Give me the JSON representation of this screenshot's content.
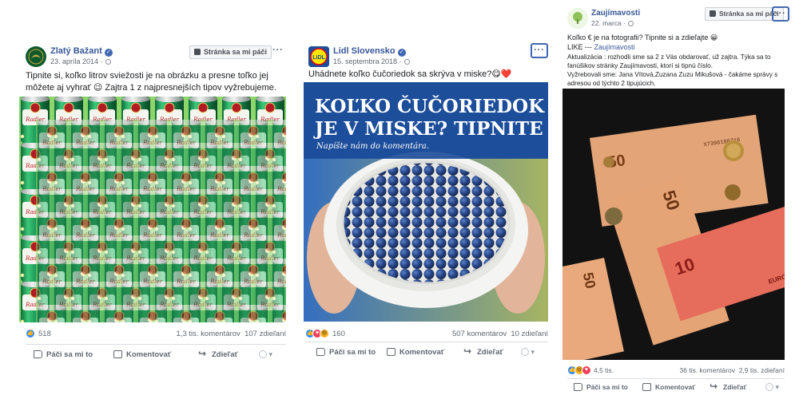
{
  "posts": [
    {
      "page_name": "Zlatý Bažant",
      "date": "23. apríla 2014 ·",
      "like_page_label": "Stránka sa mi páči",
      "more_label": "···",
      "text": "Tipnite si, koľko litrov sviežosti je na obrázku a presne toľko jej môžete aj vyhrať 😉 Zajtra 1 z najpresnejších tipov vyžrebujeme.",
      "image": {
        "can_text": "Zlatý Radler"
      },
      "reaction_count": "518",
      "comments": "1,3 tis. komentárov",
      "shares": "107 zdieľaní",
      "actions": {
        "like": "Páči sa mi to",
        "comment": "Komentovať",
        "share": "Zdieľať"
      }
    },
    {
      "page_name": "Lidl Slovensko",
      "date": "15. septembra 2018 ·",
      "more_label": "···",
      "text": "Uhádnete koľko čučoriedok sa skrýva v miske?😋❤️",
      "image": {
        "logo_text": "LIDL",
        "headline_line1": "KOĽKO ČUČORIEDOK",
        "headline_line2": "JE V MISKE? TIPNITE SI!",
        "subline": "Napíšte nám do komentára."
      },
      "reaction_count": "160",
      "comments": "507 komentárov",
      "shares": "10 zdieľaní",
      "actions": {
        "like": "Páči sa mi to",
        "comment": "Komentovať",
        "share": "Zdieľať"
      }
    },
    {
      "page_name": "Zaujímavosti",
      "date": "22. marca ·",
      "like_page_label": "Stránka sa mi páči",
      "more_label": "···",
      "text_line1": "Koľko € je na fotografii? Tipnite si a zdieľajte 😀",
      "text_line2_prefix": "LIKE --- ",
      "text_line2_link": "Zaujímavosti",
      "update": "Aktualizácia : rozhodli sme sa 2 z Vás obdarovať, už zajtra. Týka sa to fanúšikov stránky Zaujímavosti, ktorí si tipnú číslo.",
      "winners": "Vyžrebovali sme: Jana Vítová,Zuzana Zuzu Mikušová - čakáme správy s adresou od týchto 2 tipujúcich.",
      "image": {
        "note_50": "50",
        "note_10": "10",
        "euro": "EURO"
      },
      "reaction_count": "4,5 tis.",
      "comments": "36 tis. komentárov",
      "shares": "2,9 tis. zdieľaní",
      "actions": {
        "like": "Páči sa mi to",
        "comment": "Komentovať",
        "share": "Zdieľať"
      }
    }
  ],
  "colors": {
    "facebook_blue": "#4267b2",
    "link_blue": "#385898",
    "lidl_blue": "#1d4e9a",
    "lidl_yellow": "#ffe600",
    "lidl_red": "#e20019",
    "can_green": "#1e9c5a"
  },
  "icons": [
    "verified-badge-icon",
    "globe-icon",
    "thumbs-up-icon",
    "comment-icon",
    "share-icon",
    "more-options-icon"
  ]
}
